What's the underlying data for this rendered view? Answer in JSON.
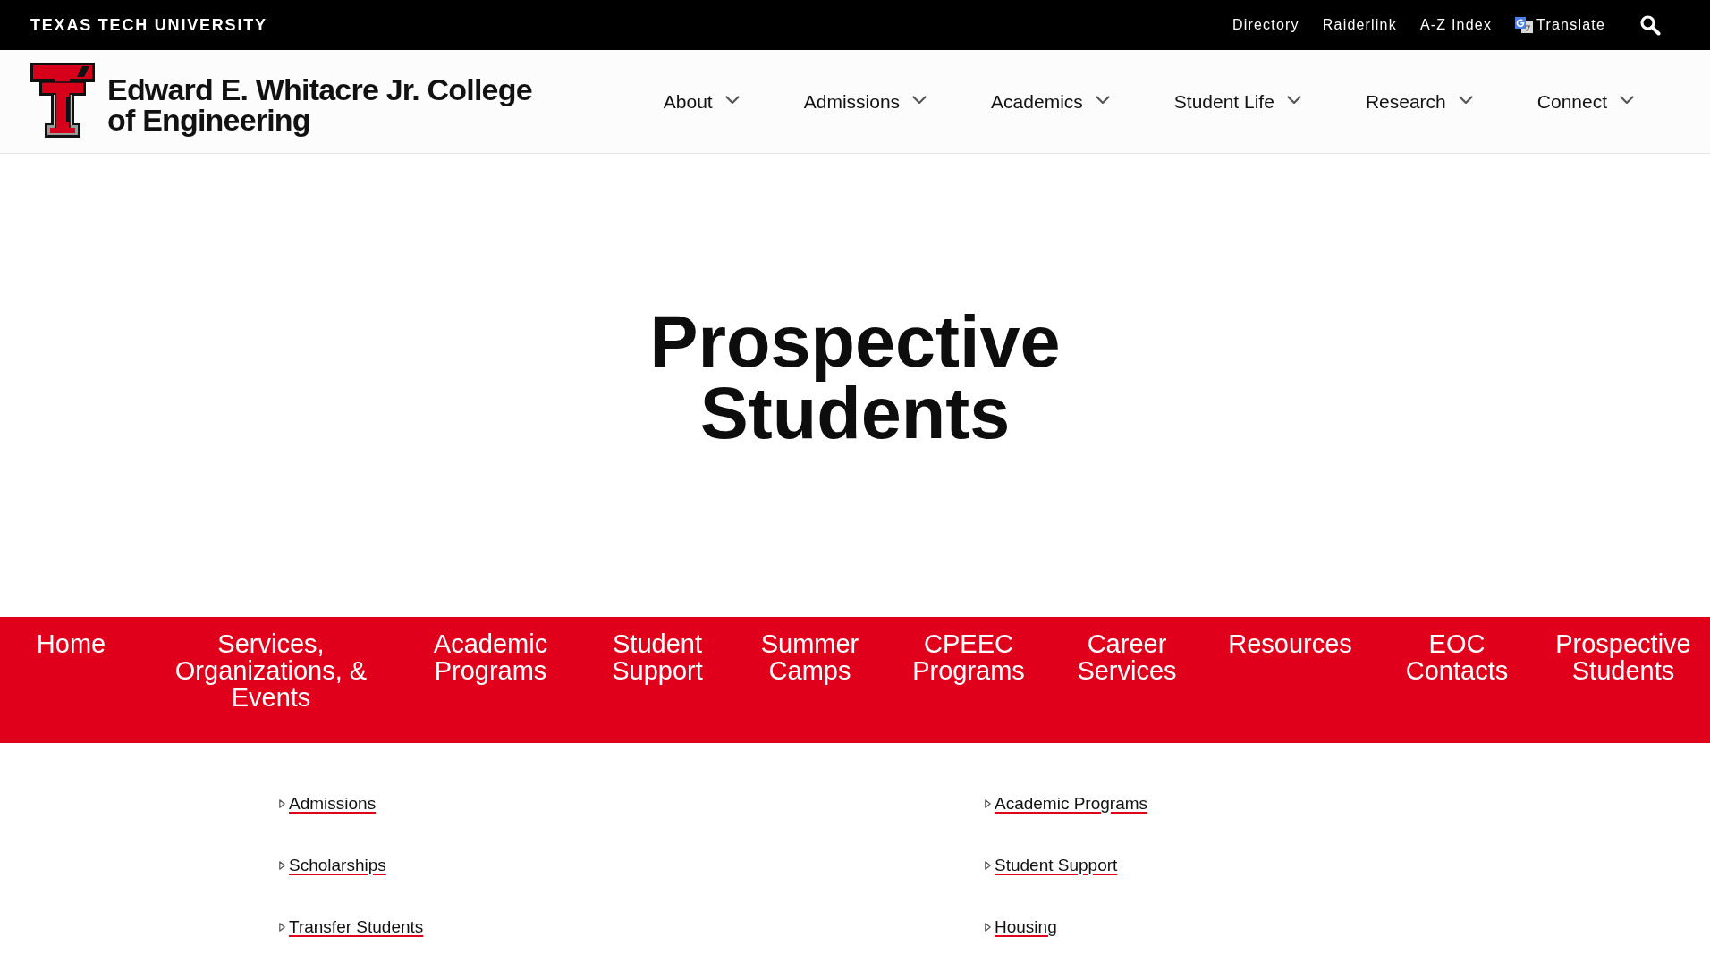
{
  "top_bar": {
    "university": "TEXAS TECH UNIVERSITY",
    "links": [
      {
        "label": "Directory",
        "kind": "link"
      },
      {
        "label": "Raiderlink",
        "kind": "link"
      },
      {
        "label": "A-Z Index",
        "kind": "link"
      },
      {
        "label": "Translate",
        "kind": "translate"
      }
    ]
  },
  "header": {
    "college_name": "Edward E. Whitacre Jr. College of Engineering",
    "menu": [
      {
        "label": "About"
      },
      {
        "label": "Admissions"
      },
      {
        "label": "Academics"
      },
      {
        "label": "Student Life"
      },
      {
        "label": "Research"
      },
      {
        "label": "Connect"
      }
    ]
  },
  "hero": {
    "title": "Prospective Students"
  },
  "section_nav": {
    "items": [
      "Home",
      "Services, Organizations, & Events",
      "Academic Programs",
      "Student Support",
      "Summer Camps",
      "CPEEC Programs",
      "Career Services",
      "Resources",
      "EOC Contacts",
      "Prospective Students"
    ]
  },
  "links": {
    "columns": [
      {
        "items": [
          "Admissions",
          "Scholarships",
          "Transfer Students"
        ]
      },
      {
        "items": [
          "Academic Programs",
          "Student Support",
          "Housing"
        ]
      }
    ]
  }
}
